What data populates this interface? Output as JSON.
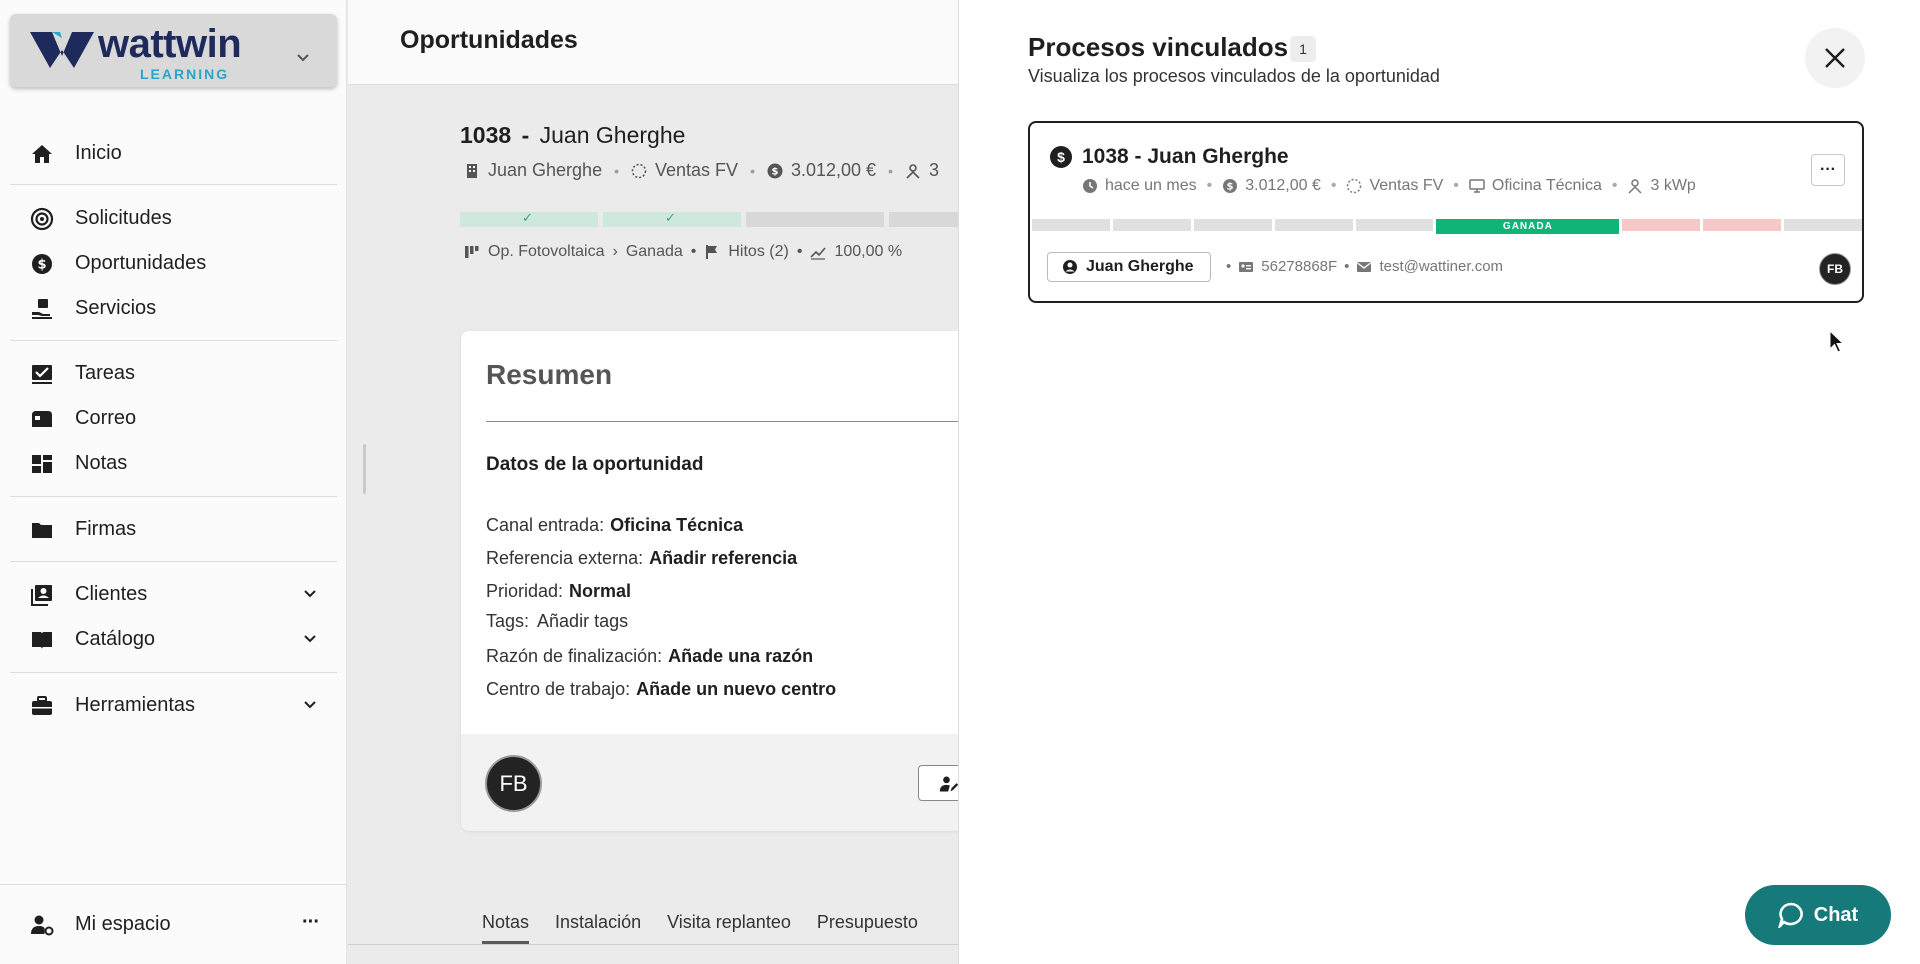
{
  "sidebar": {
    "logo_text": "wattwin",
    "logo_sub": "LEARNING",
    "items": [
      {
        "label": "Inicio",
        "icon": "home-icon"
      },
      {
        "label": "Solicitudes",
        "icon": "target-icon"
      },
      {
        "label": "Oportunidades",
        "icon": "dollar-icon"
      },
      {
        "label": "Servicios",
        "icon": "service-icon"
      },
      {
        "label": "Tareas",
        "icon": "task-icon"
      },
      {
        "label": "Correo",
        "icon": "mail-icon"
      },
      {
        "label": "Notas",
        "icon": "notes-icon"
      },
      {
        "label": "Firmas",
        "icon": "folder-icon"
      },
      {
        "label": "Clientes",
        "icon": "clients-icon"
      },
      {
        "label": "Catálogo",
        "icon": "book-icon"
      },
      {
        "label": "Herramientas",
        "icon": "toolbox-icon"
      }
    ],
    "footer_label": "Mi espacio",
    "footer_more": "···"
  },
  "main": {
    "page_title": "Oportunidades",
    "opp_id": "1038",
    "opp_sep": "-",
    "opp_name": "Juan Gherghe",
    "meta": {
      "client": "Juan Gherghe",
      "channel": "Ventas FV",
      "amount": "3.012,00 €",
      "power": "3"
    },
    "pipeline": {
      "process": "Op. Fotovoltaica",
      "stage": "Ganada",
      "milestones": "Hitos (2)",
      "probability": "100,00 %"
    },
    "summary": {
      "title": "Resumen",
      "section": "Datos de la oportunidad",
      "fields": [
        {
          "label": "Canal entrada:",
          "value": "Oficina Técnica"
        },
        {
          "label": "Referencia externa:",
          "value": "Añadir referencia"
        },
        {
          "label": "Prioridad:",
          "value": "Normal"
        },
        {
          "label": "Tags:",
          "value": "Añadir tags"
        },
        {
          "label": "Razón de finalización:",
          "value": "Añade una razón"
        },
        {
          "label": "Centro de trabajo:",
          "value": "Añade un nuevo centro"
        }
      ],
      "avatar": "FB"
    },
    "tabs": [
      "Notas",
      "Instalación",
      "Visita replanteo",
      "Presupuesto"
    ]
  },
  "panel": {
    "title": "Procesos vinculados",
    "count": "1",
    "subtitle": "Visualiza los procesos vinculados de la oportunidad",
    "process": {
      "title": "1038 - Juan Gherghe",
      "time": "hace un mes",
      "amount": "3.012,00 €",
      "channel": "Ventas FV",
      "office": "Oficina Técnica",
      "power": "3 kWp",
      "stage_label": "GANADA",
      "client": "Juan Gherghe",
      "document": "56278868F",
      "email": "test@wattiner.com",
      "avatar": "FB",
      "more": "···"
    },
    "chat_label": "Chat"
  },
  "colors": {
    "won": "#0fb577",
    "lost": "#f7c8c8",
    "chat": "#167a7a",
    "brand": "#1f2a5c"
  }
}
